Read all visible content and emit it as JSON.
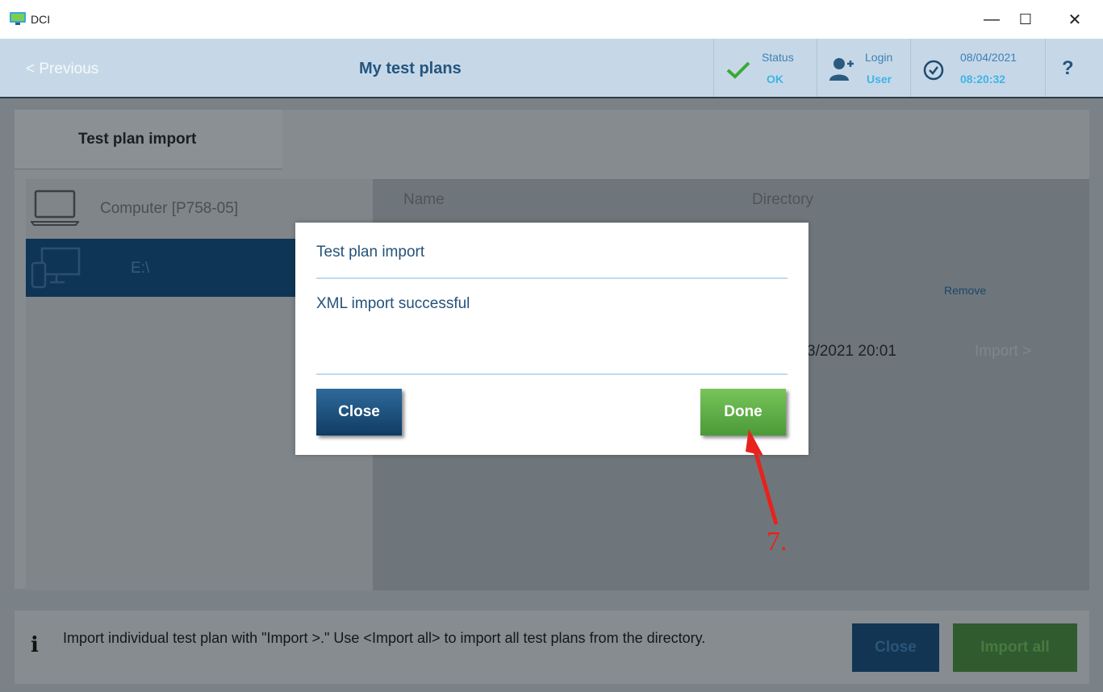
{
  "window": {
    "title": "DCI",
    "minimize": "—",
    "maximize": "☐",
    "close": "✕"
  },
  "header": {
    "previous": "< Previous",
    "title": "My test plans",
    "status_label": "Status",
    "status_value": "OK",
    "login_label": "Login",
    "login_value": "User",
    "date": "08/04/2021",
    "time": "08:20:32",
    "help": "?"
  },
  "tabs": [
    {
      "label": "Test plan import"
    }
  ],
  "sources": [
    {
      "label": "Computer [P758-05]",
      "selected": false
    },
    {
      "label": "E:\\",
      "selected": true
    }
  ],
  "table": {
    "columns": [
      "Name",
      "Directory"
    ],
    "remove_label": "Remove",
    "row_date_partial": "3/2021 20:01",
    "row_import": "Import >"
  },
  "footer": {
    "info_icon": "i",
    "text": "Import individual test plan with \"Import >.\" Use <Import all> to import all test plans from the directory.",
    "close": "Close",
    "import_all": "Import all"
  },
  "dialog": {
    "title": "Test plan import",
    "message": "XML import successful",
    "close": "Close",
    "done": "Done"
  },
  "annotation": {
    "step": "7.",
    "color": "#e8221c"
  }
}
